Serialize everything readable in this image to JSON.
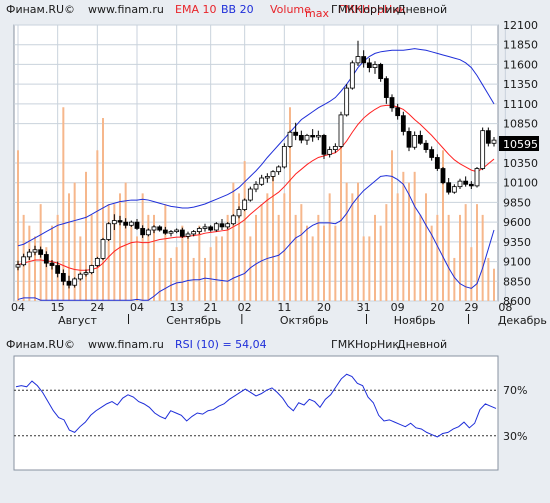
{
  "colors": {
    "background": "#e9edf2",
    "plot_bg": "#ffffff",
    "grid": "#c9d2dc",
    "bull_fill": "#ffffff",
    "bear_fill": "#000000",
    "candle_outline": "#000000",
    "ema": "#ff2222",
    "bollinger": "#1f2fd9",
    "volume": "#f6b78c",
    "rsi": "#1f2fd9",
    "rsi_level": "#333333",
    "highlight": "#000000",
    "header_text": "#1a1a1a",
    "header_blue": "#1f2fd9",
    "header_red": "#e8242a"
  },
  "header": {
    "brand": "Финам.RU©",
    "site": "www.finam.ru",
    "ema": "EMA 10",
    "bb": "BB 20",
    "volume": "Volume",
    "volume_max": "max",
    "instrument": "ГМКНорНик",
    "overlap_text": "ГМКНорНик",
    "interval": "Дневной"
  },
  "rsi_header": {
    "brand": "Финам.RU©",
    "site": "www.finam.ru",
    "label": "RSI (10) = 54,04",
    "instrument": "ГМКНорНик",
    "interval": "Дневной"
  },
  "chart_data": [
    {
      "type": "candlestick",
      "title": "ГМКНорНик Дневной",
      "indicators": [
        "EMA 10",
        "BB 20",
        "Volume"
      ],
      "ylim": [
        8600,
        12100
      ],
      "y_ticks": [
        8600,
        8850,
        9100,
        9350,
        9600,
        9850,
        10100,
        10350,
        10595,
        10850,
        11100,
        11350,
        11600,
        11850,
        12100
      ],
      "last_price": "10595",
      "x_tick_labels": [
        "04",
        "15",
        "24",
        "04",
        "13",
        "21",
        "02",
        "11",
        "20",
        "31",
        "09",
        "20",
        "29",
        "08"
      ],
      "x_tick_index": [
        0,
        7,
        14,
        21,
        28,
        34,
        40,
        47,
        54,
        61,
        67,
        74,
        80,
        86
      ],
      "months": [
        "Август",
        "Сентябрь",
        "Октябрь",
        "Ноябрь",
        "Декабрь"
      ],
      "month_index": [
        10.5,
        31,
        50.5,
        70,
        89
      ],
      "month_sep_index": [
        19.5,
        39.5,
        61.5,
        79.5
      ],
      "grid": true,
      "ohlc": [
        [
          9030,
          9110,
          8990,
          9060
        ],
        [
          9060,
          9200,
          9040,
          9160
        ],
        [
          9160,
          9260,
          9120,
          9220
        ],
        [
          9220,
          9300,
          9180,
          9250
        ],
        [
          9250,
          9290,
          9150,
          9190
        ],
        [
          9190,
          9230,
          9030,
          9080
        ],
        [
          9080,
          9120,
          9000,
          9050
        ],
        [
          9050,
          9100,
          8900,
          8950
        ],
        [
          8950,
          9000,
          8800,
          8850
        ],
        [
          8850,
          8920,
          8760,
          8800
        ],
        [
          8800,
          8900,
          8770,
          8880
        ],
        [
          8880,
          8960,
          8860,
          8940
        ],
        [
          8940,
          9000,
          8910,
          8960
        ],
        [
          8960,
          9060,
          8940,
          9050
        ],
        [
          9050,
          9160,
          9030,
          9140
        ],
        [
          9140,
          9400,
          9120,
          9380
        ],
        [
          9380,
          9600,
          9360,
          9580
        ],
        [
          9580,
          9700,
          9500,
          9620
        ],
        [
          9620,
          9680,
          9560,
          9600
        ],
        [
          9600,
          9650,
          9520,
          9560
        ],
        [
          9560,
          9620,
          9540,
          9600
        ],
        [
          9600,
          9640,
          9500,
          9520
        ],
        [
          9520,
          9560,
          9400,
          9440
        ],
        [
          9440,
          9520,
          9420,
          9500
        ],
        [
          9500,
          9560,
          9460,
          9540
        ],
        [
          9540,
          9560,
          9480,
          9500
        ],
        [
          9500,
          9540,
          9440,
          9460
        ],
        [
          9460,
          9500,
          9420,
          9480
        ],
        [
          9480,
          9520,
          9460,
          9500
        ],
        [
          9500,
          9530,
          9400,
          9420
        ],
        [
          9420,
          9480,
          9390,
          9450
        ],
        [
          9450,
          9500,
          9420,
          9480
        ],
        [
          9480,
          9540,
          9450,
          9520
        ],
        [
          9520,
          9580,
          9480,
          9540
        ],
        [
          9540,
          9560,
          9480,
          9500
        ],
        [
          9500,
          9600,
          9480,
          9580
        ],
        [
          9580,
          9640,
          9500,
          9540
        ],
        [
          9540,
          9600,
          9510,
          9580
        ],
        [
          9580,
          9700,
          9560,
          9680
        ],
        [
          9680,
          9800,
          9650,
          9760
        ],
        [
          9760,
          9900,
          9740,
          9880
        ],
        [
          9880,
          10050,
          9860,
          10020
        ],
        [
          10020,
          10120,
          9980,
          10080
        ],
        [
          10080,
          10200,
          10060,
          10160
        ],
        [
          10160,
          10220,
          10100,
          10180
        ],
        [
          10180,
          10260,
          10120,
          10240
        ],
        [
          10240,
          10320,
          10200,
          10300
        ],
        [
          10300,
          10600,
          10280,
          10560
        ],
        [
          10560,
          10760,
          10540,
          10740
        ],
        [
          10740,
          10860,
          10640,
          10700
        ],
        [
          10700,
          10760,
          10600,
          10640
        ],
        [
          10640,
          10720,
          10580,
          10700
        ],
        [
          10700,
          10780,
          10620,
          10680
        ],
        [
          10680,
          10760,
          10640,
          10700
        ],
        [
          10700,
          10720,
          10400,
          10460
        ],
        [
          10460,
          10560,
          10420,
          10520
        ],
        [
          10520,
          10600,
          10480,
          10560
        ],
        [
          10560,
          11000,
          10540,
          10960
        ],
        [
          10960,
          11350,
          10940,
          11300
        ],
        [
          11300,
          11650,
          11280,
          11620
        ],
        [
          11620,
          11900,
          11580,
          11700
        ],
        [
          11700,
          11780,
          11560,
          11620
        ],
        [
          11620,
          11680,
          11500,
          11560
        ],
        [
          11560,
          11640,
          11480,
          11600
        ],
        [
          11600,
          11620,
          11380,
          11420
        ],
        [
          11420,
          11450,
          11100,
          11180
        ],
        [
          11180,
          11220,
          11000,
          11050
        ],
        [
          11050,
          11100,
          10900,
          10950
        ],
        [
          10950,
          11000,
          10700,
          10750
        ],
        [
          10750,
          10800,
          10500,
          10550
        ],
        [
          10550,
          10750,
          10520,
          10700
        ],
        [
          10700,
          10760,
          10580,
          10600
        ],
        [
          10600,
          10640,
          10480,
          10520
        ],
        [
          10520,
          10560,
          10380,
          10420
        ],
        [
          10420,
          10460,
          10250,
          10280
        ],
        [
          10280,
          10300,
          10080,
          10100
        ],
        [
          10100,
          10160,
          9950,
          9980
        ],
        [
          9980,
          10080,
          9960,
          10050
        ],
        [
          10050,
          10150,
          10020,
          10120
        ],
        [
          10120,
          10180,
          10050,
          10080
        ],
        [
          10080,
          10120,
          10020,
          10060
        ],
        [
          10060,
          10300,
          10040,
          10280
        ],
        [
          10280,
          10800,
          10260,
          10760
        ],
        [
          10760,
          10800,
          10560,
          10600
        ],
        [
          10600,
          10680,
          10560,
          10640
        ]
      ],
      "ema": [
        9060,
        9080,
        9100,
        9120,
        9120,
        9110,
        9100,
        9080,
        9050,
        9020,
        9000,
        8990,
        8990,
        9000,
        9020,
        9080,
        9160,
        9230,
        9280,
        9310,
        9340,
        9350,
        9340,
        9340,
        9360,
        9380,
        9390,
        9400,
        9410,
        9410,
        9420,
        9430,
        9440,
        9460,
        9470,
        9480,
        9490,
        9500,
        9540,
        9580,
        9630,
        9700,
        9760,
        9820,
        9880,
        9930,
        9980,
        10050,
        10130,
        10210,
        10270,
        10330,
        10380,
        10420,
        10440,
        10460,
        10480,
        10540,
        10630,
        10740,
        10840,
        10920,
        10980,
        11030,
        11070,
        11080,
        11080,
        11060,
        11030,
        10970,
        10900,
        10840,
        10770,
        10700,
        10620,
        10540,
        10460,
        10390,
        10340,
        10300,
        10260,
        10240,
        10280,
        10340,
        10400
      ],
      "bb_upper": [
        9300,
        9320,
        9360,
        9400,
        9440,
        9480,
        9520,
        9560,
        9580,
        9600,
        9620,
        9640,
        9660,
        9700,
        9740,
        9780,
        9820,
        9840,
        9860,
        9870,
        9880,
        9880,
        9890,
        9880,
        9860,
        9840,
        9820,
        9800,
        9790,
        9780,
        9780,
        9790,
        9810,
        9830,
        9860,
        9890,
        9920,
        9950,
        9990,
        10040,
        10110,
        10180,
        10250,
        10330,
        10420,
        10500,
        10580,
        10660,
        10740,
        10820,
        10900,
        10950,
        11000,
        11050,
        11090,
        11130,
        11180,
        11260,
        11350,
        11450,
        11560,
        11640,
        11700,
        11740,
        11760,
        11770,
        11780,
        11780,
        11780,
        11790,
        11800,
        11790,
        11780,
        11760,
        11740,
        11720,
        11700,
        11680,
        11660,
        11620,
        11560,
        11460,
        11340,
        11220,
        11100
      ]
    },
    {
      "type": "bar",
      "name": "Volume",
      "values": [
        70,
        40,
        35,
        30,
        45,
        25,
        35,
        40,
        90,
        50,
        55,
        30,
        60,
        40,
        70,
        85,
        45,
        45,
        50,
        55,
        35,
        30,
        50,
        40,
        40,
        20,
        45,
        20,
        25,
        35,
        30,
        20,
        35,
        20,
        25,
        30,
        30,
        40,
        55,
        50,
        65,
        30,
        40,
        45,
        50,
        60,
        40,
        50,
        90,
        40,
        45,
        35,
        30,
        40,
        35,
        50,
        35,
        75,
        55,
        50,
        55,
        30,
        30,
        40,
        35,
        45,
        70,
        50,
        60,
        55,
        60,
        40,
        50,
        35,
        40,
        70,
        40,
        20,
        40,
        45,
        25,
        45,
        40,
        20,
        15
      ]
    },
    {
      "type": "line",
      "name": "RSI (10)",
      "ylim": [
        0,
        100
      ],
      "levels": [
        70,
        30
      ],
      "level_labels": [
        "70%",
        "30%"
      ],
      "values": [
        73,
        74,
        73,
        78,
        74,
        68,
        60,
        52,
        46,
        44,
        35,
        33,
        38,
        42,
        48,
        52,
        55,
        58,
        60,
        57,
        63,
        66,
        64,
        60,
        58,
        55,
        50,
        47,
        45,
        52,
        50,
        48,
        43,
        47,
        50,
        49,
        52,
        53,
        56,
        58,
        62,
        65,
        68,
        71,
        68,
        65,
        67,
        70,
        72,
        68,
        63,
        56,
        52,
        59,
        57,
        62,
        60,
        55,
        62,
        66,
        73,
        80,
        84,
        82,
        76,
        74,
        64,
        59,
        48,
        43,
        44,
        42,
        40,
        38,
        41,
        37,
        36,
        33,
        31,
        29,
        32,
        33,
        36,
        38,
        42,
        37,
        41,
        53,
        58,
        56,
        54
      ]
    }
  ]
}
